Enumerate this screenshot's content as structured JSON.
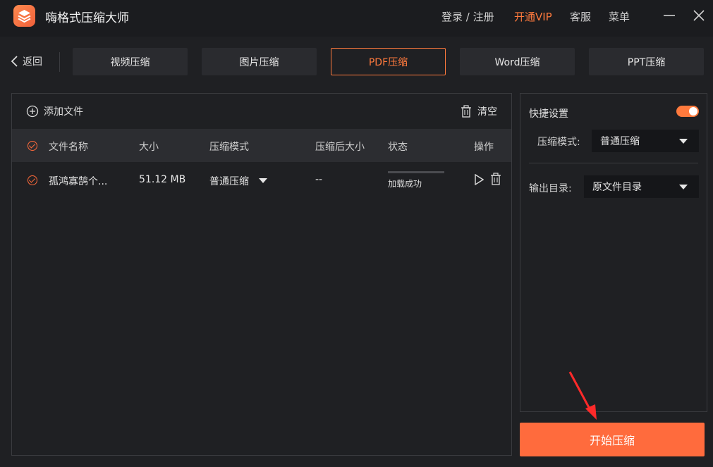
{
  "app": {
    "title": "嗨格式压缩大师"
  },
  "titlebar": {
    "login": "登录 / 注册",
    "vip": "开通VIP",
    "service": "客服",
    "menu": "菜单"
  },
  "nav": {
    "back_label": "返回",
    "tabs": [
      {
        "label": "视频压缩"
      },
      {
        "label": "图片压缩"
      },
      {
        "label": "PDF压缩",
        "active": true
      },
      {
        "label": "Word压缩"
      },
      {
        "label": "PPT压缩"
      }
    ]
  },
  "filelist": {
    "add_label": "添加文件",
    "clear_label": "清空",
    "columns": {
      "name": "文件名称",
      "size": "大小",
      "mode": "压缩模式",
      "after": "压缩后大小",
      "status": "状态",
      "ops": "操作"
    },
    "rows": [
      {
        "name": "孤鸿寡鹄个...",
        "size": "51.12 MB",
        "mode": "普通压缩",
        "after": "--",
        "status": "加载成功",
        "progress": 1.0
      }
    ]
  },
  "settings": {
    "quick_label": "快捷设置",
    "quick_enabled": true,
    "mode_label": "压缩模式:",
    "mode_value": "普通压缩",
    "output_label": "输出目录:",
    "output_value": "原文件目录"
  },
  "actions": {
    "start_label": "开始压缩"
  },
  "colors": {
    "accent": "#ff7a3d",
    "background": "#1f2023",
    "panel": "#2a2b2f"
  }
}
